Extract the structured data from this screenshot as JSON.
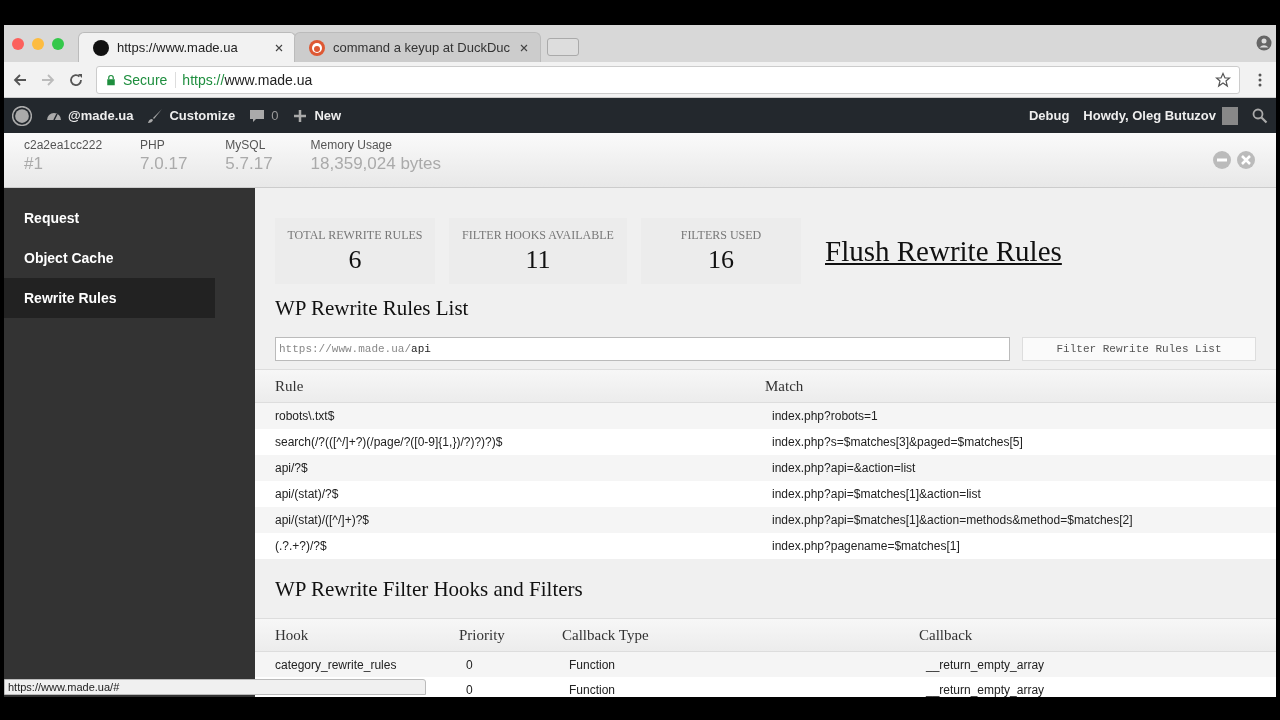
{
  "browser": {
    "tabs": [
      {
        "title": "https://www.made.ua",
        "selected": true
      },
      {
        "title": "command a keyup at DuckDuc",
        "selected": false
      }
    ],
    "address": {
      "secure_label": "Secure",
      "scheme": "https://",
      "host": "www.made.ua"
    }
  },
  "admin_bar": {
    "site": "@made.ua",
    "customize": "Customize",
    "comments": "0",
    "new": "New",
    "debug": "Debug",
    "howdy": "Howdy, Oleg Butuzov"
  },
  "debug_header": {
    "stats": [
      {
        "label": "c2a2ea1cc222",
        "value": "#1"
      },
      {
        "label": "PHP",
        "value": "7.0.17"
      },
      {
        "label": "MySQL",
        "value": "5.7.17"
      },
      {
        "label": "Memory Usage",
        "value": "18,359,024 bytes"
      }
    ]
  },
  "sidebar": {
    "items": [
      {
        "label": "Request",
        "selected": false
      },
      {
        "label": "Object Cache",
        "selected": false
      },
      {
        "label": "Rewrite Rules",
        "selected": true
      }
    ]
  },
  "summary": {
    "cards": [
      {
        "label": "TOTAL REWRITE RULES",
        "value": "6"
      },
      {
        "label": "FILTER HOOKS AVAILABLE",
        "value": "11"
      },
      {
        "label": "FILTERS USED",
        "value": "16"
      }
    ],
    "flush_link": "Flush Rewrite Rules"
  },
  "rules_section": {
    "title": "WP Rewrite Rules List",
    "filter": {
      "prefix": "https://www.made.ua/",
      "value": "api"
    },
    "filter_button": "Filter Rewrite Rules List",
    "columns": [
      "Rule",
      "Match"
    ],
    "rows": [
      {
        "rule": "robots\\.txt$",
        "match": "index.php?robots=1"
      },
      {
        "rule": "search(/?(([^/]+?)(/page/?([0-9]{1,})/?)?)?)$",
        "match": "index.php?s=$matches[3]&paged=$matches[5]"
      },
      {
        "rule": "api/?$",
        "match": "index.php?api=&action=list"
      },
      {
        "rule": "api/(stat)/?$",
        "match": "index.php?api=$matches[1]&action=list"
      },
      {
        "rule": "api/(stat)/([^/]+)?$",
        "match": "index.php?api=$matches[1]&action=methods&method=$matches[2]"
      },
      {
        "rule": "(.?.+?)/?$",
        "match": "index.php?pagename=$matches[1]"
      }
    ]
  },
  "hooks_section": {
    "title": "WP Rewrite Filter Hooks and Filters",
    "columns": [
      "Hook",
      "Priority",
      "Callback Type",
      "Callback"
    ],
    "rows": [
      {
        "hook": "category_rewrite_rules",
        "priority": "0",
        "type": "Function",
        "callback": "__return_empty_array"
      },
      {
        "priority": "0",
        "type": "Function",
        "callback": "__return_empty_array"
      }
    ]
  },
  "status_bubble": "https://www.made.ua/#"
}
